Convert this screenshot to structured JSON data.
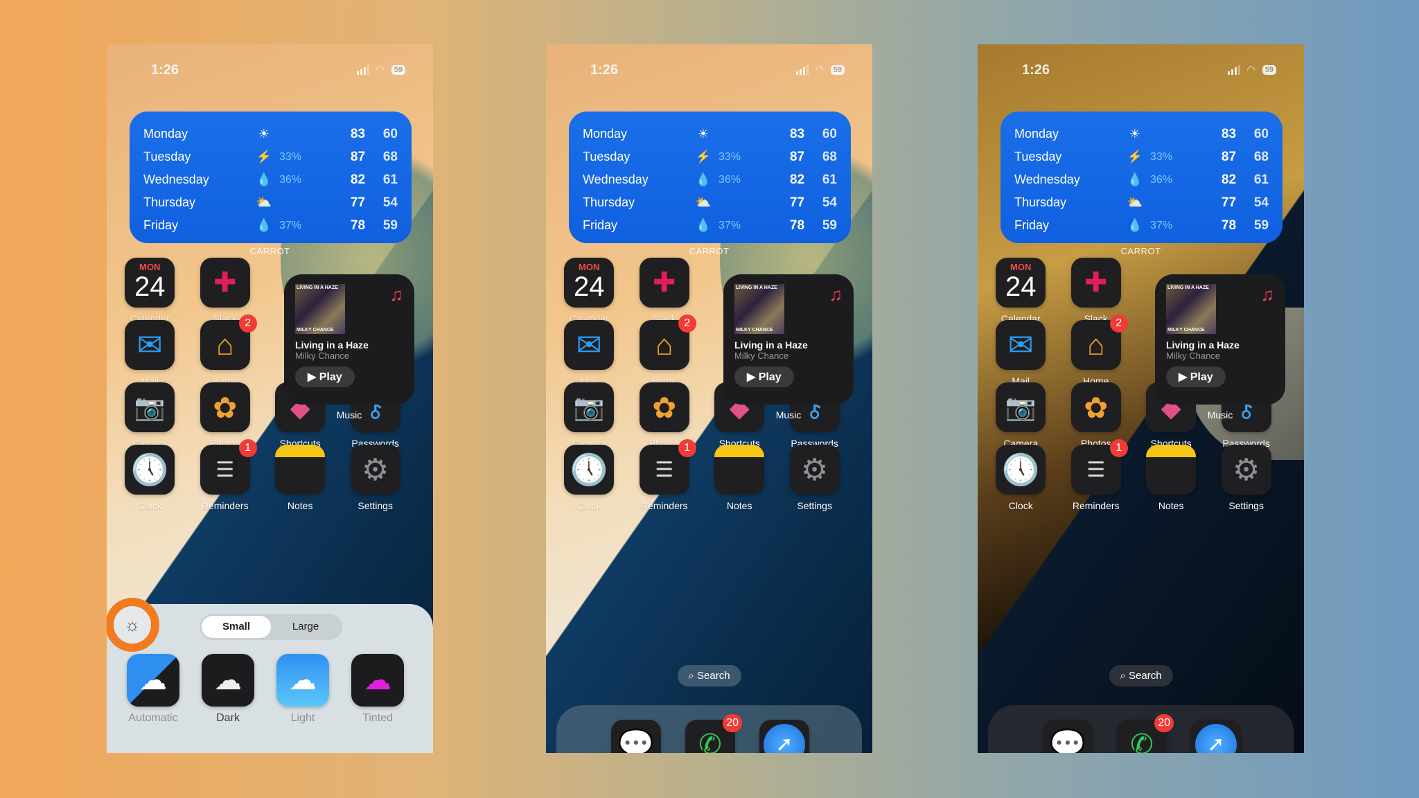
{
  "status": {
    "time": "1:26",
    "battery": "59"
  },
  "weather": {
    "widget_label": "CARROT",
    "rows": [
      {
        "day": "Monday",
        "icon": "☀",
        "icon_name": "sun-icon",
        "precip": "",
        "high": "83",
        "low": "60"
      },
      {
        "day": "Tuesday",
        "icon": "⚡",
        "icon_name": "lightning-icon",
        "precip": "33%",
        "high": "87",
        "low": "68"
      },
      {
        "day": "Wednesday",
        "icon": "💧",
        "icon_name": "raindrop-icon",
        "precip": "36%",
        "high": "82",
        "low": "61"
      },
      {
        "day": "Thursday",
        "icon": "⛅",
        "icon_name": "partly-cloudy-icon",
        "precip": "",
        "high": "77",
        "low": "54"
      },
      {
        "day": "Friday",
        "icon": "💧",
        "icon_name": "raindrop-icon",
        "precip": "37%",
        "high": "78",
        "low": "59"
      }
    ]
  },
  "apps": {
    "calendar": {
      "label": "Calendar",
      "month": "MON",
      "day": "24"
    },
    "slack": {
      "label": "Slack"
    },
    "mail": {
      "label": "Mail"
    },
    "home": {
      "label": "Home",
      "badge": "2"
    },
    "camera": {
      "label": "Camera"
    },
    "photos": {
      "label": "Photos"
    },
    "shortcuts": {
      "label": "Shortcuts"
    },
    "passwords": {
      "label": "Passwords"
    },
    "clock": {
      "label": "Clock"
    },
    "reminders": {
      "label": "Reminders",
      "badge": "1"
    },
    "notes": {
      "label": "Notes"
    },
    "settings": {
      "label": "Settings"
    }
  },
  "music": {
    "widget_label": "Music",
    "album_top": "LIVING IN A HAZE",
    "album_bottom": "MILKY CHANCE",
    "title": "Living in a Haze",
    "artist": "Milky Chance",
    "play_label": "Play"
  },
  "customize": {
    "size_options": [
      "Small",
      "Large"
    ],
    "selected_size": "Small",
    "styles": [
      "Automatic",
      "Dark",
      "Light",
      "Tinted"
    ],
    "selected_style": "Dark"
  },
  "search": {
    "label": "Search"
  },
  "dock": {
    "phone_badge": "20"
  },
  "colors": {
    "highlight_ring": "#f27a1f",
    "badge": "#f23b35",
    "weather_bg": "#1060e0"
  }
}
